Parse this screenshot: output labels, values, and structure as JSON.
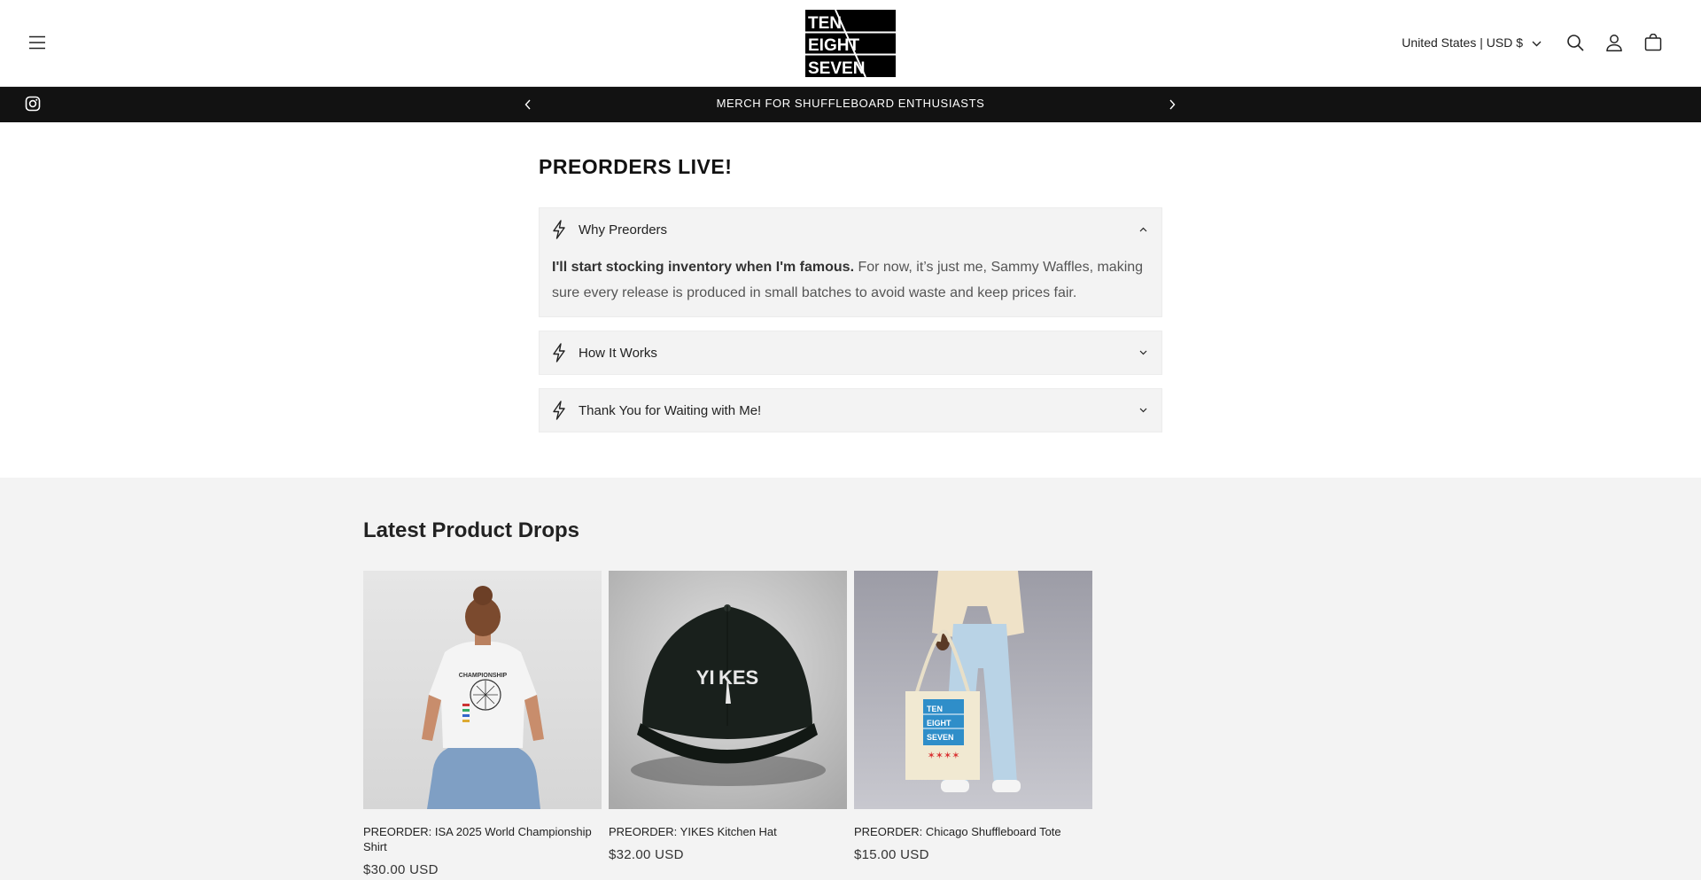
{
  "header": {
    "logo_lines": [
      "TEN",
      "EIGHT",
      "SEVEN"
    ],
    "country_selector": "United States | USD $",
    "icons": [
      "hamburger-menu-icon",
      "chevron-down-icon",
      "search-icon",
      "account-icon",
      "cart-icon"
    ]
  },
  "announcement": {
    "text": "MERCH FOR SHUFFLEBOARD ENTHUSIASTS",
    "icons": [
      "instagram-icon",
      "chevron-left-icon",
      "chevron-right-icon"
    ]
  },
  "preorders": {
    "title": "PREORDERS LIVE!",
    "accordions": [
      {
        "label": "Why Preorders",
        "expanded": true,
        "body_bold": "I'll start stocking inventory when I'm famous.",
        "body_text": " For now, it’s just me, Sammy Waffles, making sure every release is produced in small batches to avoid waste and keep prices fair."
      },
      {
        "label": "How It Works",
        "expanded": false
      },
      {
        "label": "Thank You for Waiting with Me!",
        "expanded": false
      }
    ]
  },
  "drops": {
    "title": "Latest Product Drops",
    "products": [
      {
        "title": "PREORDER: ISA 2025 World Championship Shirt",
        "price": "$30.00 USD",
        "image": "woman-wearing-white-championship-tee",
        "print_text": "CHAMPIONSHIP"
      },
      {
        "title": "PREORDER: YIKES Kitchen Hat",
        "price": "$32.00 USD",
        "image": "black-dad-cap-yikes",
        "print_text": "YI KES"
      },
      {
        "title": "PREORDER: Chicago Shuffleboard Tote",
        "price": "$15.00 USD",
        "image": "person-holding-canvas-tote",
        "print_text": [
          "TEN",
          "EIGHT",
          "SEVEN"
        ]
      }
    ]
  },
  "colors": {
    "announcement_bg": "#121212",
    "accordion_bg": "#f3f3f3",
    "section_bg": "#f3f3f3",
    "text": "#121212"
  }
}
